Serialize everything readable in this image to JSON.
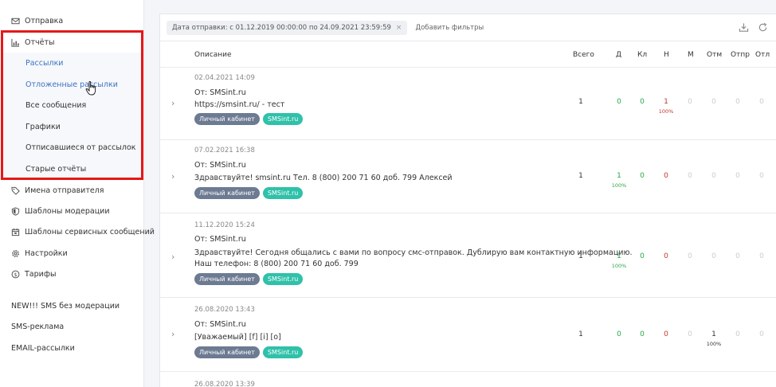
{
  "sidebar": {
    "items": [
      {
        "label": "Отправка",
        "icon": "envelope-icon"
      },
      {
        "label": "Отчёты",
        "icon": "chart-icon"
      },
      {
        "label": "Имена отправителя",
        "icon": "tag-icon"
      },
      {
        "label": "Шаблоны модерации",
        "icon": "shield-icon"
      },
      {
        "label": "Шаблоны сервисных сообщений",
        "icon": "calendar-icon"
      },
      {
        "label": "Настройки",
        "icon": "gear-icon"
      },
      {
        "label": "Тарифы",
        "icon": "dollar-icon"
      }
    ],
    "reports_sub": [
      "Рассылки",
      "Отложенные рассылки",
      "Все сообщения",
      "Графики",
      "Отписавшиеся от рассылок",
      "Старые отчёты"
    ],
    "extra_items": [
      "NEW!!! SMS без модерации",
      "SMS-реклама",
      "EMAIL-рассылки"
    ]
  },
  "filters": {
    "chip": "Дата отправки: с 01.12.2019 00:00:00 по 24.09.2021 23:59:59",
    "chip_close": "×",
    "add": "Добавить фильтры"
  },
  "table": {
    "headers": [
      "Описание",
      "Всего",
      "Д",
      "Кл",
      "Н",
      "М",
      "Отм",
      "Отпр",
      "Отл"
    ],
    "rows": [
      {
        "date": "02.04.2021 14:09",
        "from": "От: SMSint.ru",
        "text": [
          "https://smsint.ru/ - тест"
        ],
        "tags": [
          "Личный кабинет",
          "SMSint.ru"
        ],
        "values": [
          "1",
          "0",
          "0",
          "1",
          "0",
          "0",
          "0",
          "0"
        ],
        "pct": {
          "3": "100%"
        }
      },
      {
        "date": "07.02.2021 16:38",
        "from": "От: SMSint.ru",
        "text": [
          "Здравствуйте! smsint.ru Тел. 8 (800) 200 71 60 доб. 799 Алексей"
        ],
        "tags": [
          "Личный кабинет",
          "SMSint.ru"
        ],
        "values": [
          "1",
          "1",
          "0",
          "0",
          "0",
          "0",
          "0",
          "0"
        ],
        "pct": {
          "1": "100%"
        }
      },
      {
        "date": "11.12.2020 15:24",
        "from": "От: SMSint.ru",
        "text": [
          "Здравствуйте! Сегодня общались с вами по вопросу смс-отправок. Дублирую вам контактную информацию.",
          "Наш телефон: 8 (800) 200 71 60 доб. 799"
        ],
        "tags": [
          "Личный кабинет",
          "SMSint.ru"
        ],
        "values": [
          "1",
          "1",
          "0",
          "0",
          "0",
          "0",
          "0",
          "0"
        ],
        "pct": {
          "1": "100%"
        }
      },
      {
        "date": "26.08.2020 13:43",
        "from": "От: SMSint.ru",
        "text": [
          "[Уважаемый] [f] [i] [o]"
        ],
        "tags": [
          "Личный кабинет",
          "SMSint.ru"
        ],
        "values": [
          "1",
          "0",
          "0",
          "0",
          "0",
          "1",
          "0",
          "0"
        ],
        "pct": {
          "5": "100%"
        }
      },
      {
        "date": "26.08.2020 13:39"
      }
    ]
  },
  "colors": {
    "accent_link": "#3a72c4",
    "highlight_box": "#e51818",
    "delivered": "#28a745",
    "undelivered": "#c0392b",
    "tag_gray": "#6c7a92",
    "tag_teal": "#2fc1a9"
  }
}
